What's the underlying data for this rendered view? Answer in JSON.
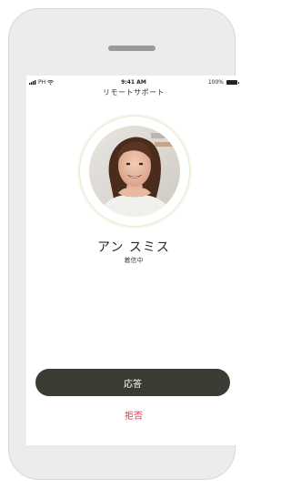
{
  "status_bar": {
    "carrier": "PH",
    "time": "9:41 AM",
    "battery": "100%",
    "icons": [
      "signal-icon",
      "wifi-icon",
      "battery-icon"
    ]
  },
  "screen": {
    "title": "リモートサポート"
  },
  "caller": {
    "name": "アン スミス",
    "status": "着信中"
  },
  "actions": {
    "accept_label": "応答",
    "decline_label": "拒否"
  },
  "colors": {
    "accept_bg": "#3b3b33",
    "decline_text": "#e0324a",
    "device_frame": "#ececec"
  }
}
